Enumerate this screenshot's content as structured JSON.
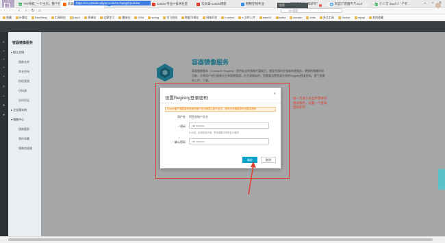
{
  "browser": {
    "tabs": [
      {
        "label": "360导航_一个主页，整个世界",
        "color": "#2ea84b"
      },
      {
        "label": "容器镜像服务",
        "color": "#ff6a00",
        "active": true
      },
      {
        "label": "在线JSON解析在线格式化",
        "color": "#3a8ee6"
      },
      {
        "label": "CSDN-专业IT技术社区",
        "color": "#e03e2d"
      },
      {
        "label": "写文章-CSDN博客",
        "color": "#e03e2d"
      },
      {
        "label": "网络在线专业",
        "color": "#3a8ee6"
      },
      {
        "label": "阿里云服务 (高级版)",
        "color": "#f5a623"
      },
      {
        "label": "阿里云容器服务ACS",
        "color": "#3a8ee6"
      },
      {
        "label": "什么是 Docker | 手机",
        "color": "#2ea84b"
      }
    ],
    "url": "https://cr.console.aliyun.com/cn-hangzhou/new",
    "search_placeholder": "360搜索",
    "bookmarks": [
      "收藏",
      "计算站",
      "BootStrap",
      "工具网站",
      "LayUI",
      "资源站",
      "达摩学习",
      "趣味站",
      "OSM",
      "spring",
      "学习网站",
      "数据可视化",
      "网络开发",
      "b-select",
      "b-文件上传",
      "easeUI",
      "kafka",
      "dandan",
      "zhifu",
      "多点工具",
      "Docker",
      "mysql",
      "其他收藏"
    ]
  },
  "topnav": {
    "brand": "管理控制台",
    "search_placeholder": "搜索",
    "items": [
      "消息",
      "费用",
      "工单",
      "备案",
      "企业",
      "支持与服务",
      "简体中文"
    ],
    "message_count": "1"
  },
  "sidebar": {
    "title": "容器镜像服务",
    "groups": [
      {
        "label": "默认实例",
        "items": [
          "镜像仓库",
          "命名空间",
          "授权管理",
          "代码源",
          "访问凭证"
        ]
      },
      {
        "label": "企业版实例"
      },
      {
        "label": "镜像中心",
        "items": [
          "镜像搜索",
          "我的收藏",
          "镜像加速器"
        ]
      }
    ]
  },
  "hero": {
    "title": "容器镜像服务",
    "desc": "容器镜像服务（Container Registry）提供安全的镜像托管能力，稳定的国内外镜像构建服务，便捷的镜像授权功能，方便用户进行镜像全生命周期管理。在开通服务时，您需要设置登录仓库的Registry登录密码，便于镜像的上传、下载。"
  },
  "modal": {
    "title": "设置Registry登录密码",
    "notice": "Docker客户端登录时使用的用户名为阿里云账户全名，密码为开通服务时设置的密码",
    "username_label": "用户名",
    "username_value": "阿里云账户全名",
    "password_label": "密码",
    "password_value": "••••••••••",
    "password_hint": "8-32位，必须包含字母、符号或数字中的至少两项",
    "confirm_label": "确认密码",
    "confirm_value": "••••••••••",
    "required_mark": "*",
    "ok_label": "确定",
    "cancel_label": "取消"
  },
  "annotation": {
    "text": "第一次进入会显示需要开通该服务，设置一个登录密码即可"
  }
}
